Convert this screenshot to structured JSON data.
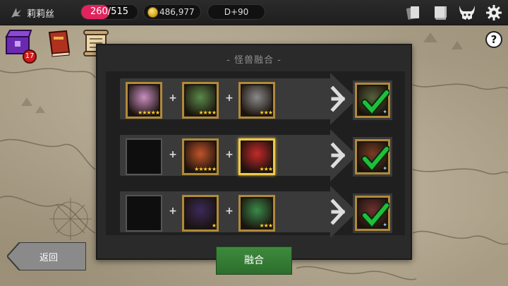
{
  "player": {
    "name": "莉莉丝",
    "icon": "wing-icon"
  },
  "resources": {
    "hp_text": "260/515",
    "hp_current": 260,
    "hp_max": 515,
    "gold_text": "486,977",
    "day_text": "D+90"
  },
  "top_icons": [
    "cards-icon",
    "scroll-book-icon",
    "demon-helmet-icon",
    "gear-icon"
  ],
  "shortcuts": {
    "chest_badge": "17"
  },
  "help_label": "?",
  "panel": {
    "title": "- 怪兽融合 -"
  },
  "fusion_rows": [
    {
      "slots": [
        {
          "filled": true,
          "stars": "★★★★★",
          "color": "#c98fc0",
          "selected": false
        },
        {
          "filled": true,
          "stars": "★★★★",
          "color": "#5a8a4a",
          "selected": false
        },
        {
          "filled": true,
          "stars": "★★★",
          "color": "#8a8a8a",
          "selected": false
        }
      ],
      "result": {
        "color": "#6a7a4a",
        "checked": true
      }
    },
    {
      "slots": [
        {
          "filled": false
        },
        {
          "filled": true,
          "stars": "★★★★★",
          "color": "#c0542a",
          "selected": false
        },
        {
          "filled": true,
          "stars": "★★★",
          "color": "#c42a2a",
          "selected": true
        }
      ],
      "result": {
        "color": "#9a4a2a",
        "checked": true
      }
    },
    {
      "slots": [
        {
          "filled": false
        },
        {
          "filled": true,
          "stars": "★",
          "color": "#3a2a5a",
          "selected": false
        },
        {
          "filled": true,
          "stars": "★★★",
          "color": "#3a8a4a",
          "selected": false
        }
      ],
      "result": {
        "color": "#8a3a3a",
        "checked": true
      }
    }
  ],
  "plus_sign": "+",
  "buttons": {
    "fuse": "融合",
    "back": "返回"
  },
  "colors": {
    "fuse_button": "#3e8a3e",
    "hp_bar": "#e0245e",
    "frame_gold": "#b08a3a",
    "check_green": "#1fbf3a"
  }
}
